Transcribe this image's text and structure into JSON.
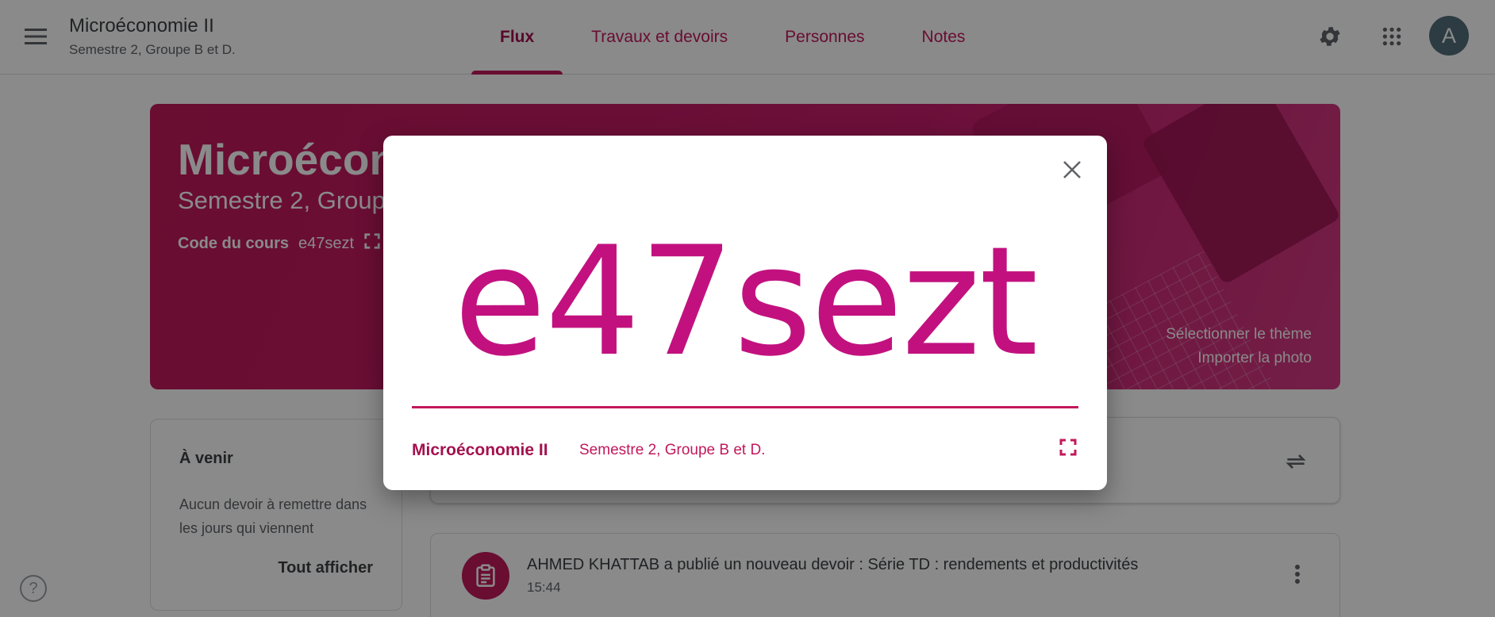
{
  "header": {
    "class_title": "Microéconomie II",
    "class_subtitle": "Semestre 2, Groupe B et D.",
    "tabs": [
      {
        "label": "Flux",
        "active": true
      },
      {
        "label": "Travaux et devoirs",
        "active": false
      },
      {
        "label": "Personnes",
        "active": false
      },
      {
        "label": "Notes",
        "active": false
      }
    ],
    "avatar_letter": "A",
    "icons": [
      "menu-icon",
      "gear-icon",
      "apps-grid-icon"
    ]
  },
  "banner": {
    "title": "Microéconomie II",
    "subtitle": "Semestre 2, Groupe B et D.",
    "code_label": "Code du cours",
    "code_value": "e47sezt",
    "select_theme": "Sélectionner le thème",
    "import_photo": "Importer la photo"
  },
  "upcoming": {
    "title": "À venir",
    "text": "Aucun devoir à remettre dans les jours qui viennent",
    "link": "Tout afficher"
  },
  "stream": {
    "post_text": "AHMED KHATTAB a publié un nouveau devoir : Série TD : rendements et productivités",
    "post_time": "15:44"
  },
  "dialog": {
    "code": "e47sezt",
    "class_name": "Microéconomie II",
    "section": "Semestre 2, Groupe B et D."
  },
  "colors": {
    "accent": "#c2185b",
    "code_color": "#c2117f",
    "scrim": "rgba(0,0,0,0.46)"
  }
}
